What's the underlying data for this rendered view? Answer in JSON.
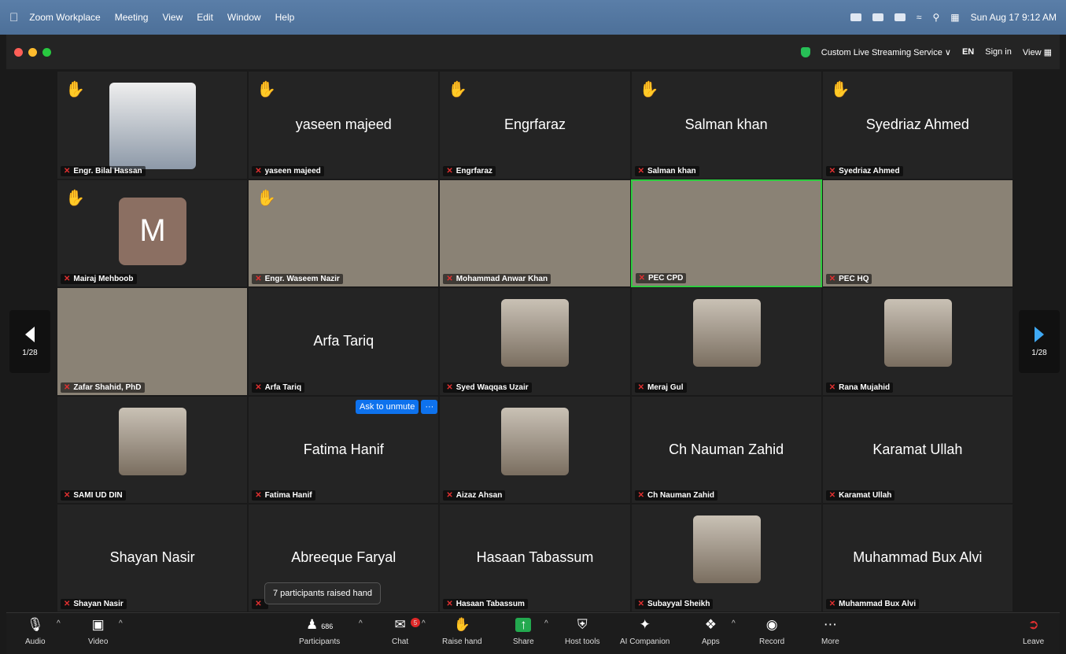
{
  "menubar": {
    "app": "Zoom Workplace",
    "items": [
      "Meeting",
      "View",
      "Edit",
      "Window",
      "Help"
    ],
    "datetime": "Sun Aug 17  9:12 AM"
  },
  "titlebar": {
    "streaming": "Custom Live Streaming Service ∨",
    "lang": "EN",
    "signin": "Sign in",
    "view": "View"
  },
  "pager": {
    "left": "1/28",
    "right": "1/28"
  },
  "tiles": [
    {
      "name": "Engr. Bilal Hassan",
      "kind": "photo",
      "hand": true
    },
    {
      "name": "yaseen majeed",
      "big": "yaseen majeed",
      "hand": true
    },
    {
      "name": "Engrfaraz",
      "big": "Engrfaraz",
      "hand": true
    },
    {
      "name": "Salman khan",
      "big": "Salman khan",
      "hand": true
    },
    {
      "name": "Syedriaz Ahmed",
      "big": "Syedriaz Ahmed",
      "hand": true
    },
    {
      "name": "Mairaj Mehboob",
      "kind": "avatar",
      "avatar": "M",
      "hand": true
    },
    {
      "name": "Engr. Waseem Nazir",
      "kind": "video",
      "hand": true
    },
    {
      "name": "Mohammad Anwar Khan",
      "kind": "video"
    },
    {
      "name": "PEC CPD",
      "kind": "video",
      "active": true
    },
    {
      "name": "PEC HQ",
      "kind": "video"
    },
    {
      "name": "Zafar Shahid, PhD",
      "kind": "video"
    },
    {
      "name": "Arfa Tariq",
      "big": "Arfa Tariq"
    },
    {
      "name": "Syed Waqqas Uzair",
      "kind": "photo"
    },
    {
      "name": "Meraj Gul",
      "kind": "photo"
    },
    {
      "name": "Rana Mujahid",
      "kind": "photo"
    },
    {
      "name": "SAMI UD DIN",
      "kind": "photo"
    },
    {
      "name": "Fatima Hanif",
      "big": "Fatima Hanif"
    },
    {
      "name": "Aizaz Ahsan",
      "kind": "photo"
    },
    {
      "name": "Ch Nauman Zahid",
      "big": "Ch Nauman Zahid"
    },
    {
      "name": "Karamat Ullah",
      "big": "Karamat Ullah"
    },
    {
      "name": "Shayan Nasir",
      "big": "Shayan Nasir"
    },
    {
      "name": "",
      "big": "Abreeque Faryal"
    },
    {
      "name": "Hasaan Tabassum",
      "big": "Hasaan Tabassum"
    },
    {
      "name": "Subayyal Sheikh",
      "kind": "photo"
    },
    {
      "name": "Muhammad Bux Alvi",
      "big": "Muhammad Bux Alvi"
    }
  ],
  "unmute": {
    "label": "Ask to unmute",
    "more": "···"
  },
  "tooltip": "7 participants raised hand",
  "toolbar": {
    "audio": "Audio",
    "video": "Video",
    "participants": "Participants",
    "participants_count": "686",
    "chat": "Chat",
    "chat_badge": "5",
    "raise_hand": "Raise hand",
    "share": "Share",
    "host_tools": "Host tools",
    "ai": "AI Companion",
    "apps": "Apps",
    "record": "Record",
    "more": "More",
    "leave": "Leave"
  }
}
